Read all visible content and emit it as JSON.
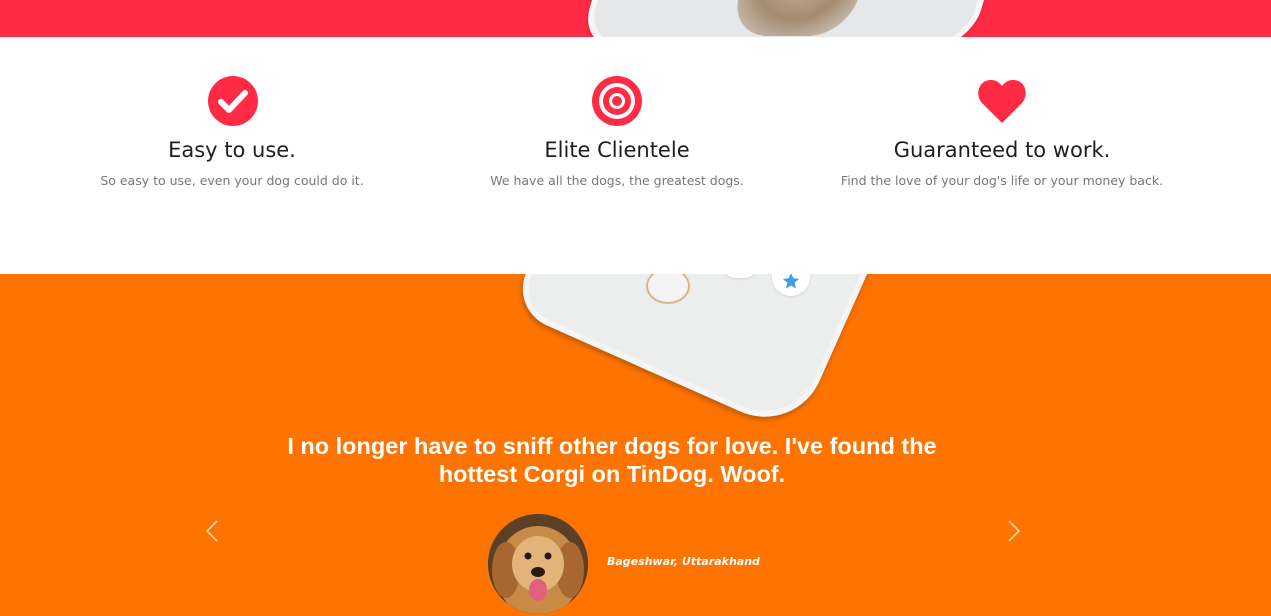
{
  "colors": {
    "brand_red": "#ff2b45",
    "brand_orange": "#ff7400",
    "text_dark": "#1e1e1e",
    "text_muted": "#777777"
  },
  "features": [
    {
      "icon": "check-circle-icon",
      "title": "Easy to use.",
      "description": "So easy to use, even your dog could do it."
    },
    {
      "icon": "bullseye-icon",
      "title": "Elite Clientele",
      "description": "We have all the dogs, the greatest dogs."
    },
    {
      "icon": "heart-icon",
      "title": "Guaranteed to work.",
      "description": "Find the love of your dog's life or your money back."
    }
  ],
  "testimonial": {
    "quote": "I no longer have to sniff other dogs for love. I've found the hottest Corgi on TinDog. Woof.",
    "caption": "Bageshwar, Uttarakhand",
    "avatar_icon": "dog-avatar"
  },
  "carousel": {
    "prev_icon": "chevron-left-icon",
    "next_icon": "chevron-right-icon"
  }
}
